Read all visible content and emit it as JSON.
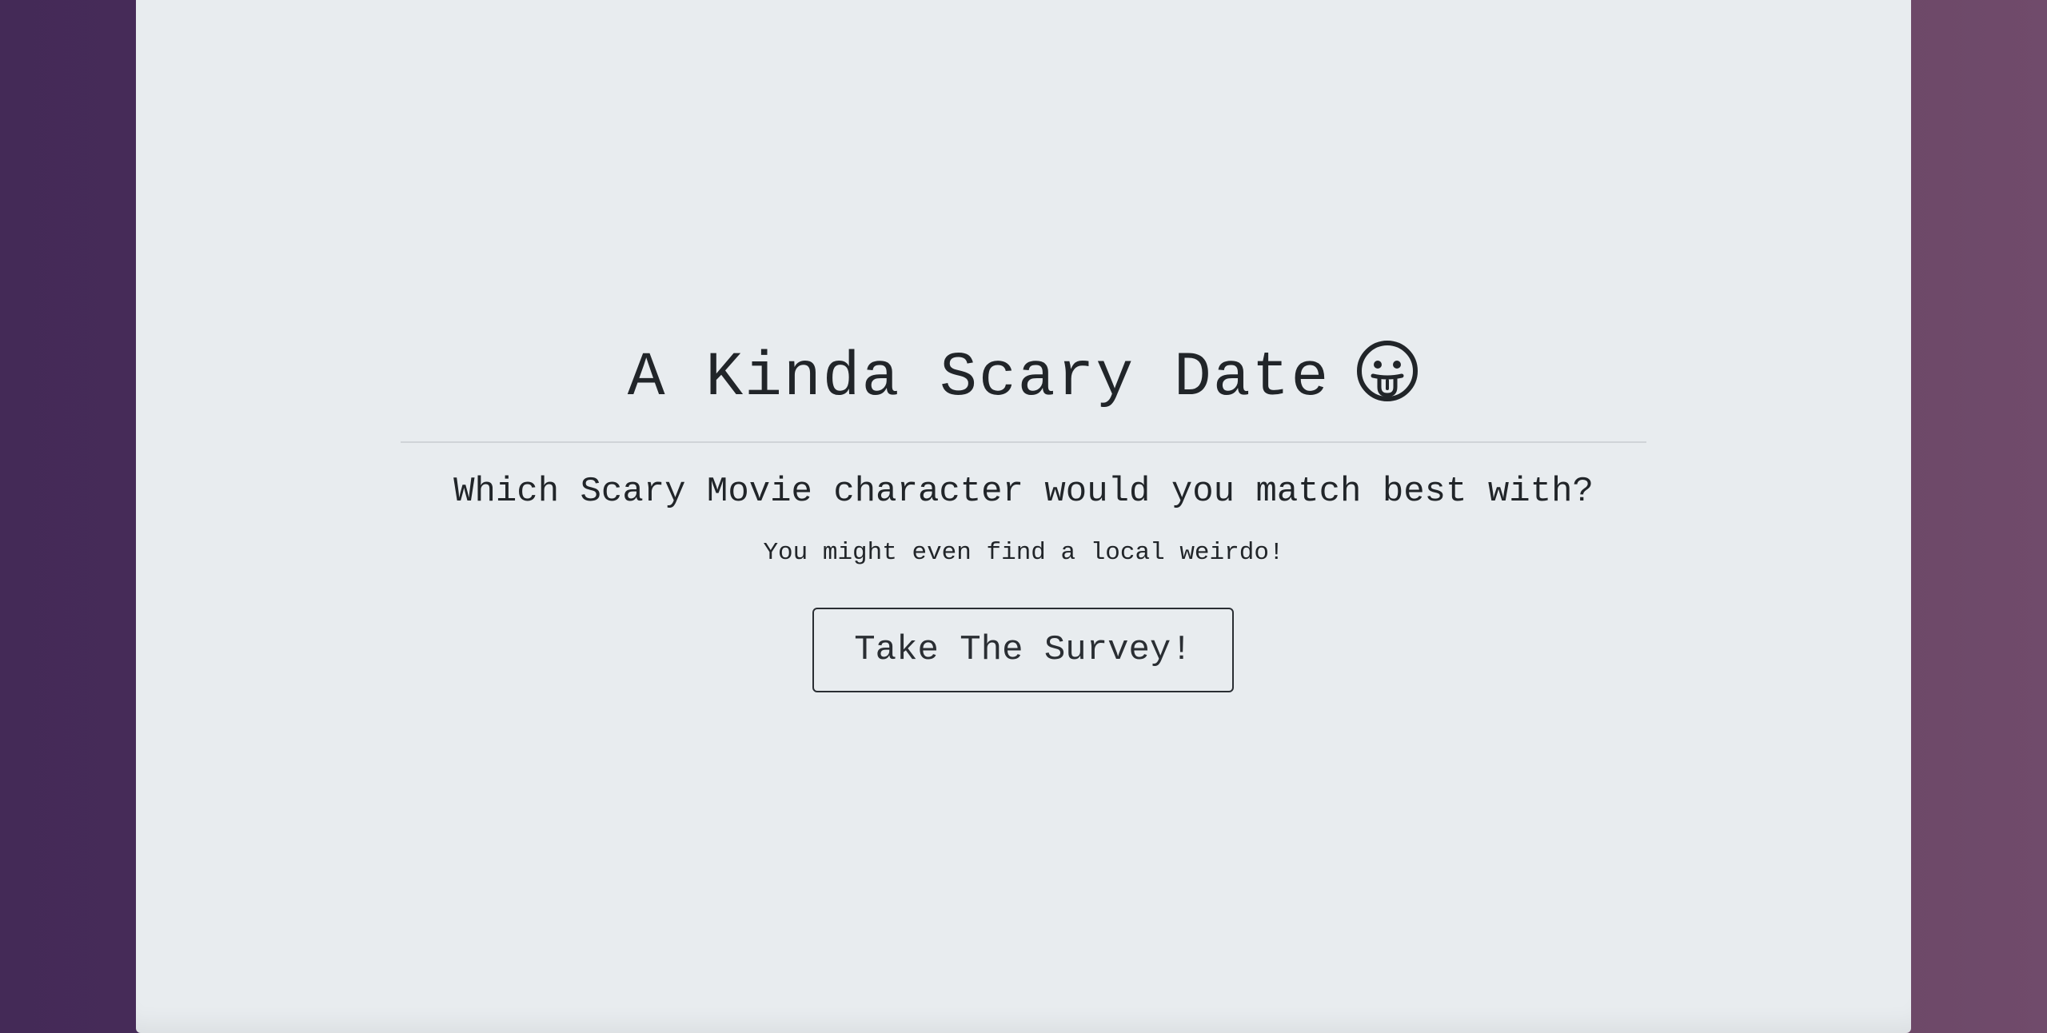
{
  "hero": {
    "title": "A Kinda Scary Date",
    "title_icon": "tongue-out-face-icon",
    "subtitle": "Which Scary Movie character would you match best with?",
    "lead": "You might even find a local weirdo!",
    "cta_label": "Take The Survey!"
  },
  "colors": {
    "background_left": "#442a57",
    "background_right": "#704b6b",
    "panel": "#e8ecef",
    "text": "#212529"
  }
}
